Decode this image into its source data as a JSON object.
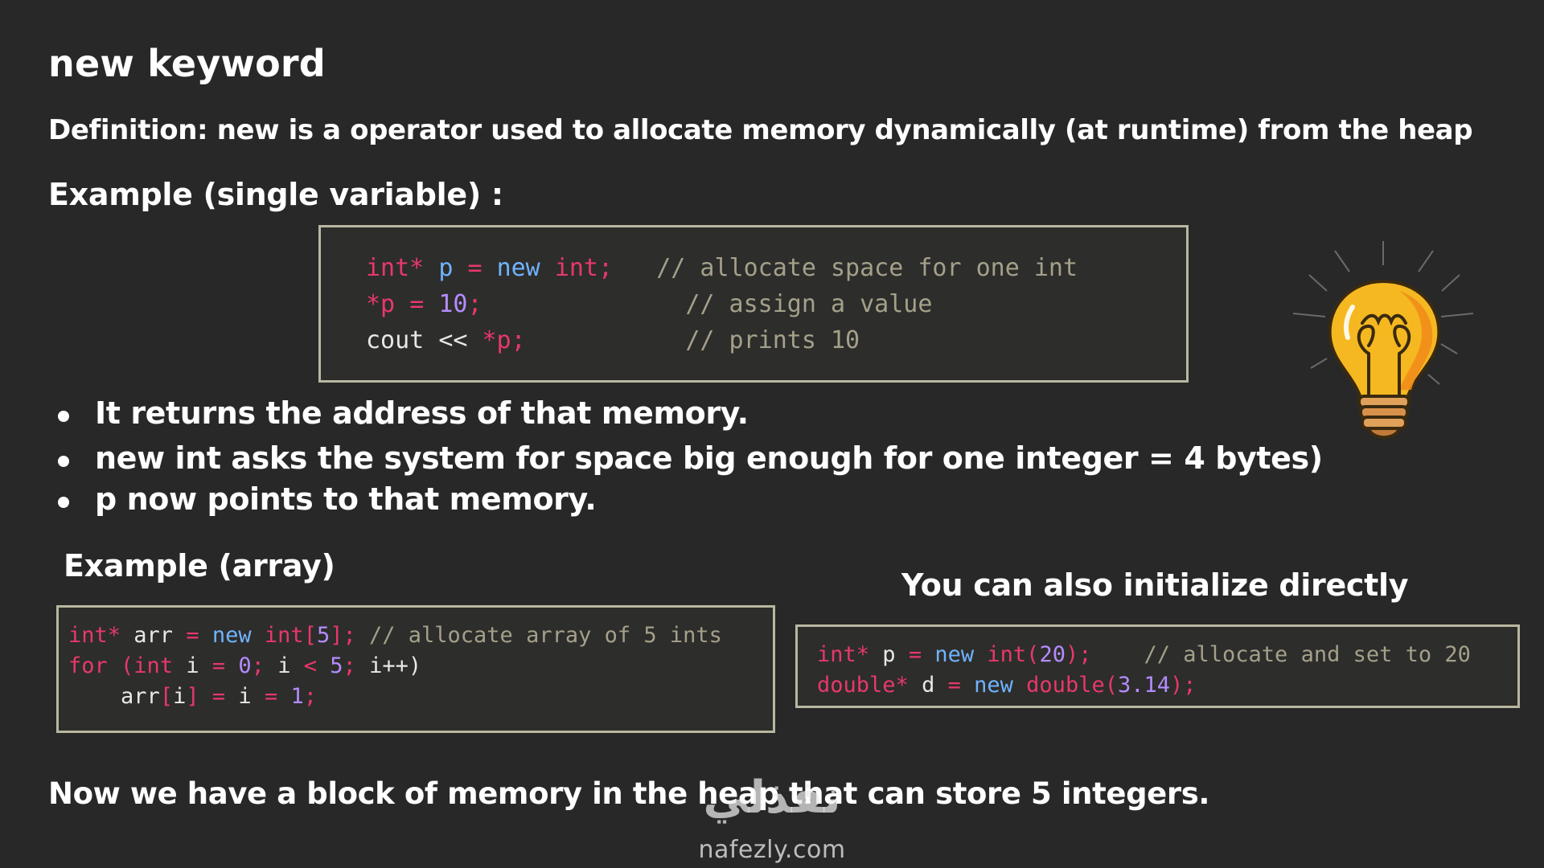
{
  "title": "new keyword",
  "definition": "Definition: new is a operator used to allocate memory dynamically (at runtime) from the heap",
  "example_single": {
    "heading": "Example (single variable) :",
    "code": {
      "line1": {
        "kw1": "int*",
        "var": "p",
        "op": "=",
        "new": "new",
        "kw2": "int;",
        "comment": "// allocate space for one int"
      },
      "line2": {
        "var": "*p",
        "op": "=",
        "num": "10",
        "punc": ";",
        "comment": "// assign a value"
      },
      "line3": {
        "cout": "cout",
        "op": "<<",
        "var": "*p",
        "punc": ";",
        "comment": "// prints 10"
      }
    }
  },
  "bullets": [
    "It returns the address of that memory.",
    "new int asks the system for space big enough for one integer = 4 bytes)",
    "p now points to that memory."
  ],
  "example_array": {
    "heading": "Example (array)",
    "code": {
      "line1": {
        "kw1": "int*",
        "var": "arr",
        "op": "=",
        "new": "new",
        "kw2": "int[",
        "num": "5",
        "kw3": "];",
        "comment": "// allocate array of 5 ints"
      },
      "line2": {
        "for": "for",
        "open": "(int",
        "i1": "i",
        "eq": "=",
        "zero": "0",
        "semi1": ";",
        "i2": "i",
        "lt": "<",
        "five": "5",
        "semi2": ";",
        "inc": "i++)"
      },
      "line3": {
        "arr": "arr",
        "idx_open": "[",
        "i1": "i",
        "idx_close": "]",
        "eq1": "=",
        "i2": "i",
        "eq2": "=",
        "one": "1",
        "semi": ";"
      }
    }
  },
  "init_direct": {
    "heading": "You can also initialize directly",
    "code": {
      "line1": {
        "kw1": "int*",
        "var": "p",
        "op": "=",
        "new": "new",
        "kw2": "int(",
        "num": "20",
        "kw3": ");",
        "comment": "// allocate and set to 20"
      },
      "line2": {
        "kw1": "double*",
        "var": "d",
        "op": "=",
        "new": "new",
        "kw2": "double(",
        "num": "3.14",
        "kw3": ");"
      }
    }
  },
  "conclusion": "Now we have a block of memory in the heap that can store 5 integers.",
  "watermark": {
    "arabic": "نفذلي",
    "url": "nafezly.com"
  },
  "icons": {
    "bulb": "lightbulb-icon",
    "bullet": "bullet-dot-icon"
  },
  "colors": {
    "background": "#282828",
    "keyword": "#e8386b",
    "variable": "#6fb3ff",
    "number": "#b48cff",
    "comment": "#a4a08a",
    "code_border": "#b9b7a0",
    "bulb_yellow": "#f5b820"
  }
}
